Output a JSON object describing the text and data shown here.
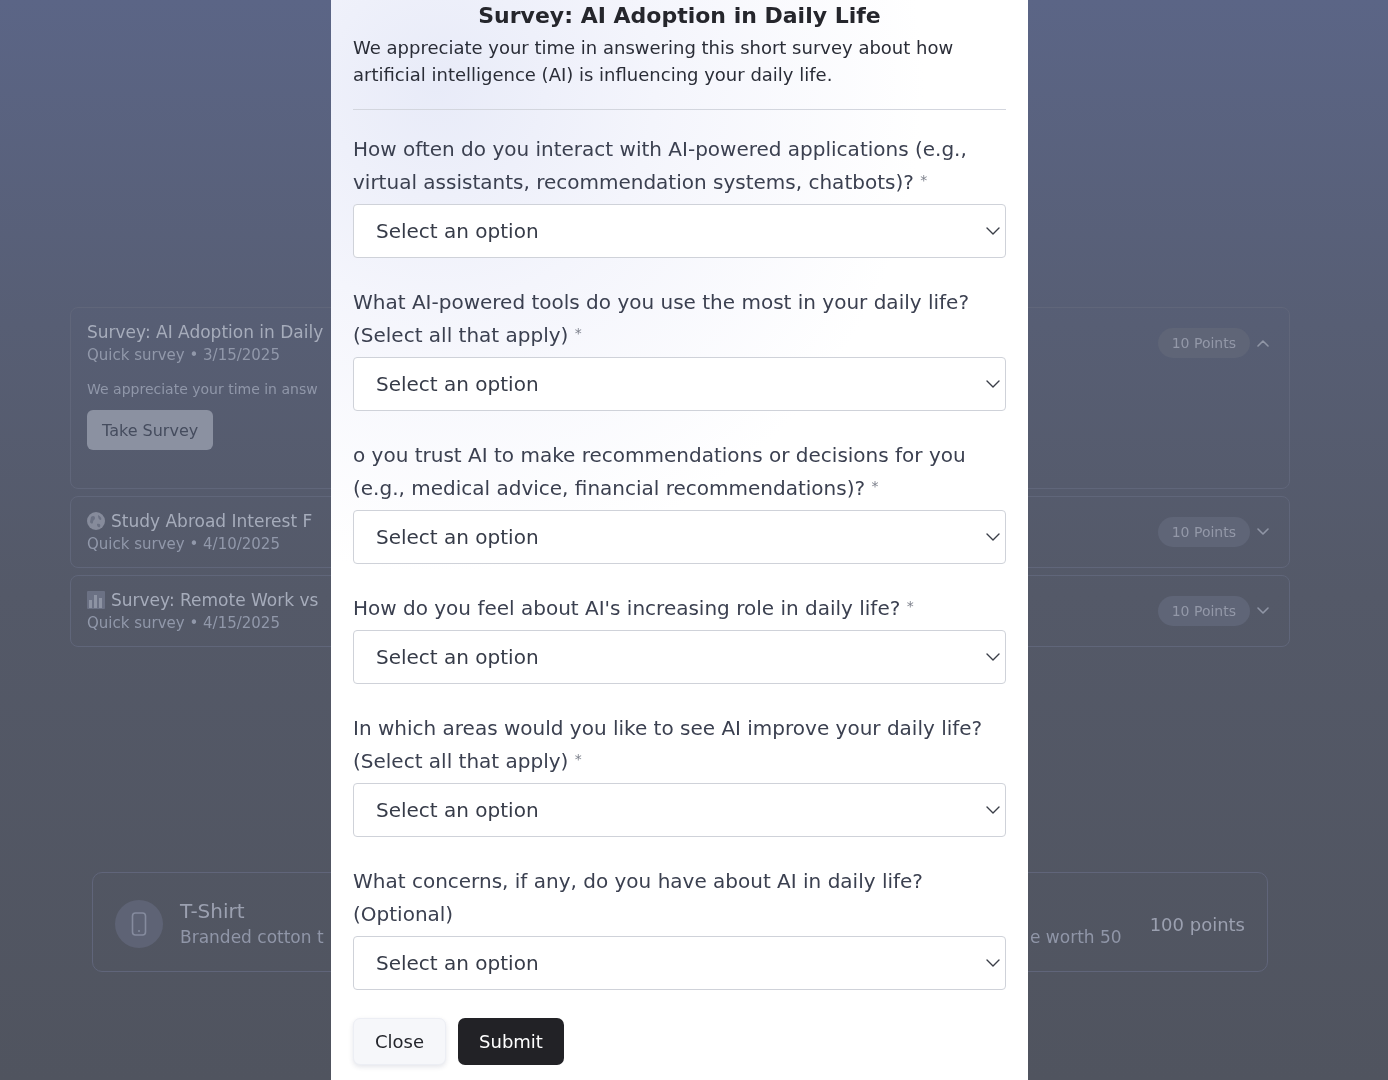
{
  "page": {
    "surveys": [
      {
        "kind": "plain",
        "title": "Survey: AI Adoption in Daily",
        "meta": "Quick survey • 3/15/2025",
        "points": "10 Points",
        "expanded": true,
        "description": "We appreciate your time in answ",
        "action": "Take Survey"
      },
      {
        "kind": "globe",
        "title": "Study Abroad Interest F",
        "meta": "Quick survey • 4/10/2025",
        "points": "10 Points",
        "expanded": false
      },
      {
        "kind": "chart",
        "title": "Survey: Remote Work vs",
        "meta": "Quick survey • 4/15/2025",
        "points": "10 Points",
        "expanded": false
      }
    ],
    "rewards": [
      {
        "name": "T-Shirt",
        "description_parts": [
          "Branded cotton t",
          "e worth 50"
        ],
        "points": "100 points"
      }
    ]
  },
  "dialog": {
    "title": "Survey: AI Adoption in Daily Life",
    "description": "We appreciate your time in answering this short survey about how artificial intelligence (AI) is influencing your daily life.",
    "questions": [
      {
        "label": "How often do you interact with AI-powered applications (e.g., virtual assistants, recommendation systems, chatbots)? $^{*}$",
        "placeholder": "Select an option"
      },
      {
        "label": "What AI-powered tools do you use the most in your daily life? (Select all that apply) $^{*}$",
        "placeholder": "Select an option"
      },
      {
        "label": "o you trust AI to make recommendations or decisions for you (e.g., medical advice, financial recommendations)? $^{*}$",
        "placeholder": "Select an option"
      },
      {
        "label": "How do you feel about AI's increasing role in daily life? $^{*}$",
        "placeholder": "Select an option"
      },
      {
        "label": "In which areas would you like to see AI improve your daily life? (Select all that apply) $^{*}$",
        "placeholder": "Select an option"
      },
      {
        "label": "What concerns, if any, do you have about AI in daily life? (Optional)",
        "placeholder": "Select an option"
      }
    ],
    "buttons": [
      {
        "label": "Close",
        "kind": "close"
      },
      {
        "label": "Submit",
        "kind": "submit"
      }
    ]
  }
}
